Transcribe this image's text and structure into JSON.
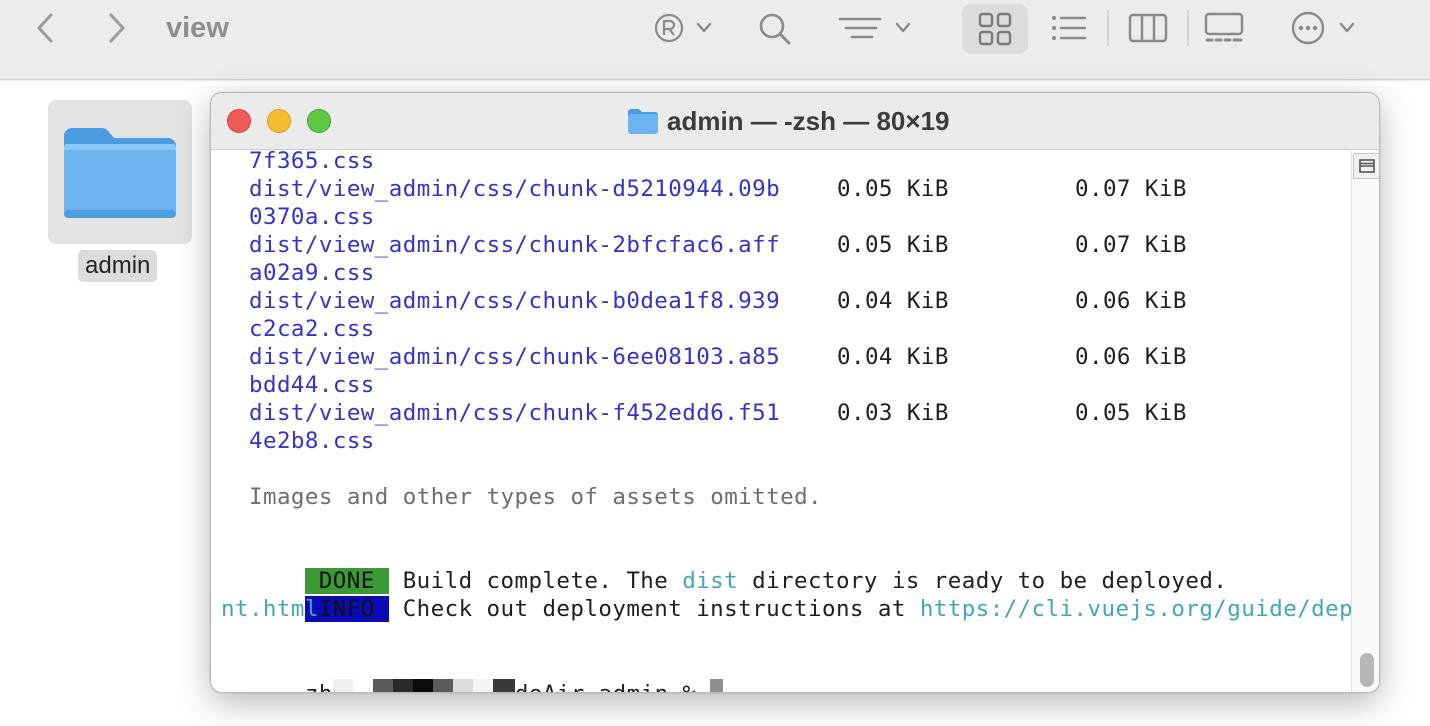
{
  "finder": {
    "title": "view",
    "folder": {
      "name": "admin",
      "color": "#6bb4f0"
    }
  },
  "terminal": {
    "title": "admin — -zsh — 80×19",
    "lines": [
      {
        "file": "7f365.css"
      },
      {
        "file": "dist/view_admin/css/chunk-d5210944.09b",
        "size": "0.05 KiB",
        "gzip": "0.07 KiB"
      },
      {
        "file": "0370a.css"
      },
      {
        "file": "dist/view_admin/css/chunk-2bfcfac6.aff",
        "size": "0.05 KiB",
        "gzip": "0.07 KiB"
      },
      {
        "file": "a02a9.css"
      },
      {
        "file": "dist/view_admin/css/chunk-b0dea1f8.939",
        "size": "0.04 KiB",
        "gzip": "0.06 KiB"
      },
      {
        "file": "c2ca2.css"
      },
      {
        "file": "dist/view_admin/css/chunk-6ee08103.a85",
        "size": "0.04 KiB",
        "gzip": "0.06 KiB"
      },
      {
        "file": "bdd44.css"
      },
      {
        "file": "dist/view_admin/css/chunk-f452edd6.f51",
        "size": "0.03 KiB",
        "gzip": "0.05 KiB"
      },
      {
        "file": "4e2b8.css"
      }
    ],
    "omitted_note": "Images and other types of assets omitted.",
    "done": {
      "badge": " DONE ",
      "text_before": " Build complete. The ",
      "highlight": "dist",
      "text_after": " directory is ready to be deployed."
    },
    "info": {
      "badge": " INFO ",
      "text": " Check out deployment instructions at ",
      "url_part1": "https://cli.vuejs.org/guide/deployme",
      "url_part2": "nt.html"
    },
    "prompt": {
      "user_prefix": "zh",
      "host_suffix": "deAir admin % "
    }
  },
  "colors": {
    "path_blue": "#3434c8",
    "link_cyan": "#43a6b8",
    "done_green": "#3b9a36",
    "info_blue": "#0b0bb5"
  }
}
